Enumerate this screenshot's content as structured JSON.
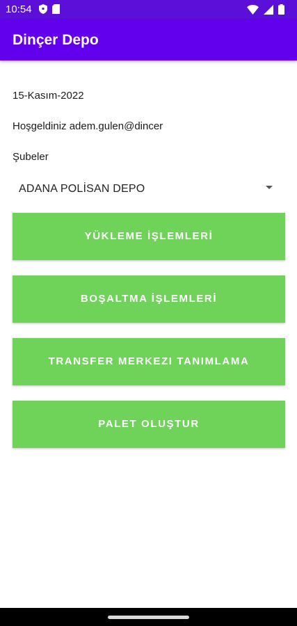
{
  "status_bar": {
    "time": "10:54",
    "left_icons": [
      "shield-icon",
      "sd-card-icon"
    ],
    "right_icons": [
      "wifi-icon",
      "signal-icon",
      "battery-icon"
    ]
  },
  "app_bar": {
    "title": "Dinçer Depo"
  },
  "main": {
    "date": "15-Kasım-2022",
    "welcome": "Hoşgeldiniz adem.gulen@dincer",
    "branches_label": "Şubeler",
    "branch_selected": "ADANA POLİSAN DEPO",
    "buttons": [
      {
        "label": "YÜKLEME İŞLEMLERİ"
      },
      {
        "label": "BOŞALTMA İŞLEMLERİ"
      },
      {
        "label": "TRANSFER MERKEZI TANIMLAMA"
      },
      {
        "label": "PALET OLUŞTUR"
      }
    ]
  },
  "colors": {
    "status_bar": "#5b0fd9",
    "app_bar": "#6200ee",
    "button": "#6fd35a",
    "background": "#ffffff"
  }
}
